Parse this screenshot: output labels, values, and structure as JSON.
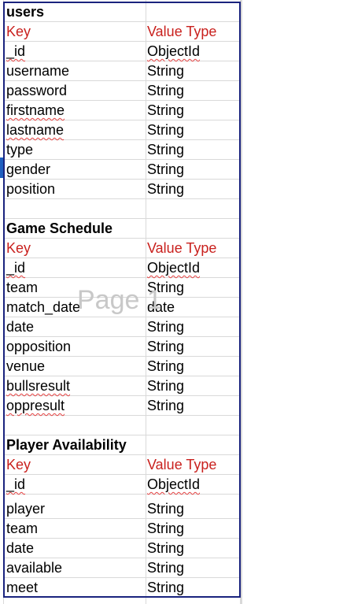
{
  "watermark": "Page 1",
  "sections": [
    {
      "title": "users",
      "header_key": "Key",
      "header_type": "Value Type",
      "rows": [
        {
          "key": "_id",
          "type": "ObjectId"
        },
        {
          "key": "username",
          "type": "String"
        },
        {
          "key": "password",
          "type": "String"
        },
        {
          "key": "firstname",
          "type": "String"
        },
        {
          "key": "lastname",
          "type": "String"
        },
        {
          "key": "type",
          "type": "String"
        },
        {
          "key": "gender",
          "type": "String"
        },
        {
          "key": "position",
          "type": "String"
        }
      ]
    },
    {
      "title": "Game Schedule",
      "header_key": "Key",
      "header_type": "Value Type",
      "rows": [
        {
          "key": "_id",
          "type": "ObjectId"
        },
        {
          "key": "team",
          "type": "String"
        },
        {
          "key": "match_date",
          "type": "date"
        },
        {
          "key": "date",
          "type": "String"
        },
        {
          "key": "opposition",
          "type": "String"
        },
        {
          "key": "venue",
          "type": "String"
        },
        {
          "key": "bullsresult",
          "type": "String"
        },
        {
          "key": "oppresult",
          "type": "String"
        }
      ]
    },
    {
      "title": "Player Availability",
      "header_key": "Key",
      "header_type": "Value Type",
      "rows": [
        {
          "key": "_id",
          "type": "ObjectId"
        },
        {
          "key": "player",
          "type": "String"
        },
        {
          "key": "team",
          "type": "String"
        },
        {
          "key": "date",
          "type": "String"
        },
        {
          "key": "available",
          "type": "String"
        },
        {
          "key": "meet",
          "type": "String"
        }
      ]
    }
  ]
}
